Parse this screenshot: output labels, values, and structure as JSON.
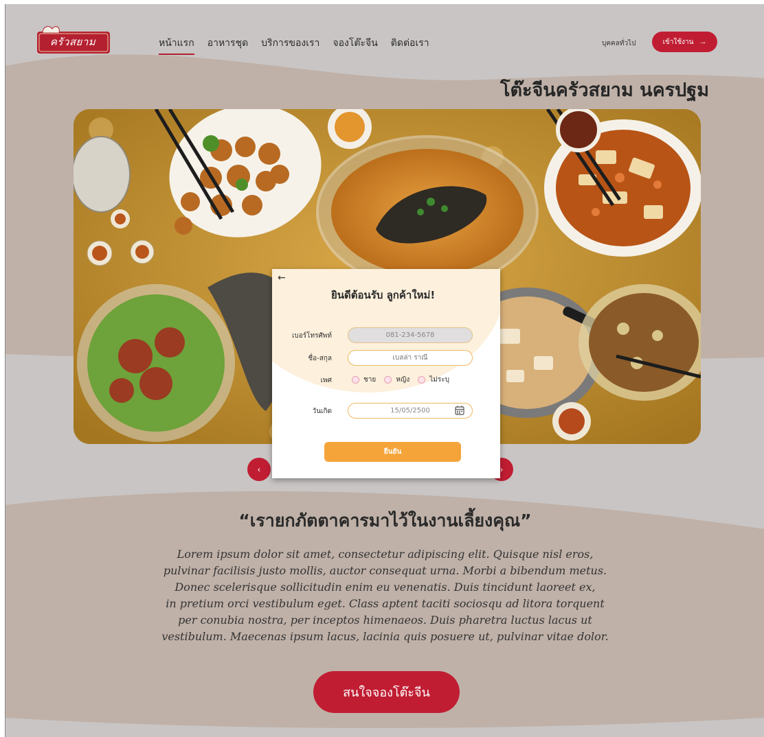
{
  "header": {
    "logo_text": "ครัวสยาม",
    "nav": [
      {
        "label": "หน้าแรก",
        "active": true
      },
      {
        "label": "อาหารชุด",
        "active": false
      },
      {
        "label": "บริการของเรา",
        "active": false
      },
      {
        "label": "จองโต๊ะจีน",
        "active": false
      },
      {
        "label": "ติดต่อเรา",
        "active": false
      }
    ],
    "user_type": "บุคคลทั่วไป",
    "login_label": "เข้าใช้งาน",
    "login_arrow": "→"
  },
  "hero": {
    "title": "โต๊ะจีนครัวสยาม นครปฐม"
  },
  "modal": {
    "back": "←",
    "title": "ยินดีต้อนรับ ลูกค้าใหม่!",
    "phone_label": "เบอร์โทรศัพท์",
    "phone_value": "081-234-5678",
    "name_label": "ชื่อ-สกุล",
    "name_placeholder": "เบลล่า ราณี",
    "gender_label": "เพศ",
    "gender_options": [
      "ชาย",
      "หญิง",
      "ไม่ระบุ"
    ],
    "birthday_label": "วันเกิด",
    "birthday_value": "15/05/2500",
    "confirm_label": "ยืนยัน"
  },
  "carousel": {
    "prev": "‹",
    "next": "›"
  },
  "content": {
    "quote": "“เรายกภัตตาคารมาไว้ในงานเลี้ยงคุณ”",
    "body": "Lorem ipsum dolor sit amet, consectetur adipiscing elit. Quisque nisl eros,\npulvinar facilisis justo mollis, auctor consequat urna. Morbi a bibendum metus.\nDonec scelerisque sollicitudin enim eu venenatis. Duis tincidunt laoreet ex,\nin pretium orci vestibulum eget. Class aptent taciti sociosqu ad litora torquent\nper conubia nostra, per inceptos himenaeos. Duis pharetra luctus lacus ut\nvestibulum. Maecenas ipsum lacus, lacinia quis posuere ut, pulvinar vitae dolor.",
    "cta_label": "สนใจจองโต๊ะจีน"
  },
  "colors": {
    "brand_red": "#c01d33",
    "accent_orange": "#f5a43a",
    "background_grey": "#c9c5c4",
    "background_taupe": "#bfb1a8"
  }
}
